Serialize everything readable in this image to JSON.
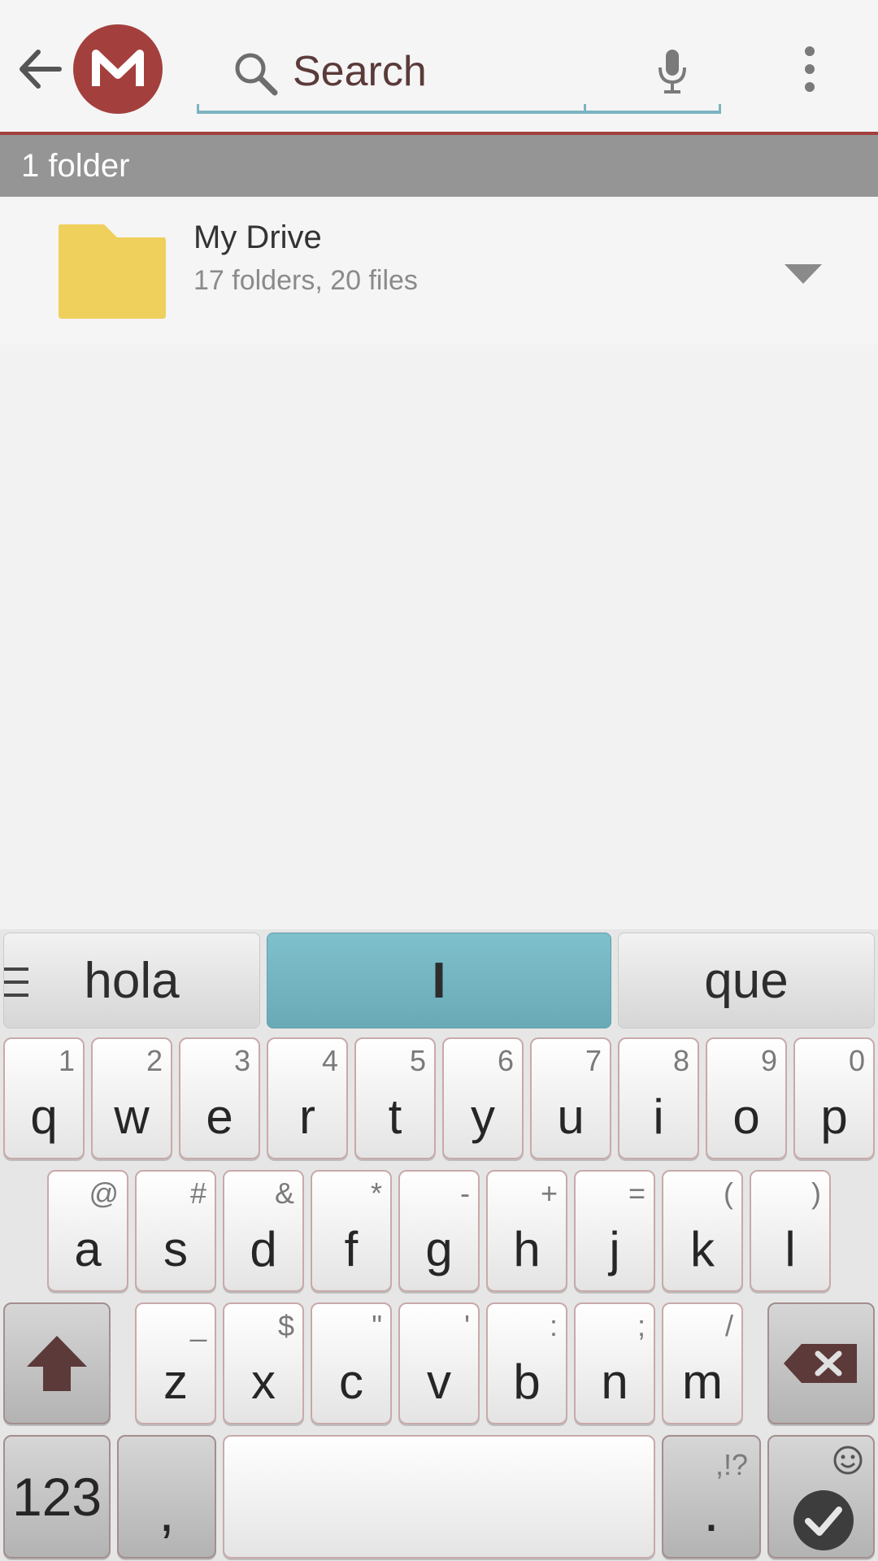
{
  "app": {
    "search": {
      "placeholder": "Search",
      "value": ""
    },
    "accent_color": "#a3403e"
  },
  "section": {
    "header": "1 folder"
  },
  "list": {
    "items": [
      {
        "title": "My Drive",
        "subtitle": "17 folders, 20 files",
        "icon": "folder-icon"
      }
    ]
  },
  "keyboard": {
    "suggestions": [
      "hola",
      "I",
      "que"
    ],
    "row1": [
      {
        "key": "q",
        "hint": "1"
      },
      {
        "key": "w",
        "hint": "2"
      },
      {
        "key": "e",
        "hint": "3"
      },
      {
        "key": "r",
        "hint": "4"
      },
      {
        "key": "t",
        "hint": "5"
      },
      {
        "key": "y",
        "hint": "6"
      },
      {
        "key": "u",
        "hint": "7"
      },
      {
        "key": "i",
        "hint": "8"
      },
      {
        "key": "o",
        "hint": "9"
      },
      {
        "key": "p",
        "hint": "0"
      }
    ],
    "row2": [
      {
        "key": "a",
        "hint": "@"
      },
      {
        "key": "s",
        "hint": "#"
      },
      {
        "key": "d",
        "hint": "&"
      },
      {
        "key": "f",
        "hint": "*"
      },
      {
        "key": "g",
        "hint": "-"
      },
      {
        "key": "h",
        "hint": "+"
      },
      {
        "key": "j",
        "hint": "="
      },
      {
        "key": "k",
        "hint": "("
      },
      {
        "key": "l",
        "hint": ")"
      }
    ],
    "row3": [
      {
        "key": "z",
        "hint": "_"
      },
      {
        "key": "x",
        "hint": "$"
      },
      {
        "key": "c",
        "hint": "\""
      },
      {
        "key": "v",
        "hint": "'"
      },
      {
        "key": "b",
        "hint": ":"
      },
      {
        "key": "n",
        "hint": ";"
      },
      {
        "key": "m",
        "hint": "/"
      }
    ],
    "numbers_key": "123",
    "comma_key": ",",
    "period_key": ".",
    "period_hint": ",!?",
    "shift_icon": "shift-arrow-icon",
    "delete_icon": "backspace-icon",
    "enter_icon": "checkmark-icon",
    "emoji_icon": "smiley-icon"
  }
}
